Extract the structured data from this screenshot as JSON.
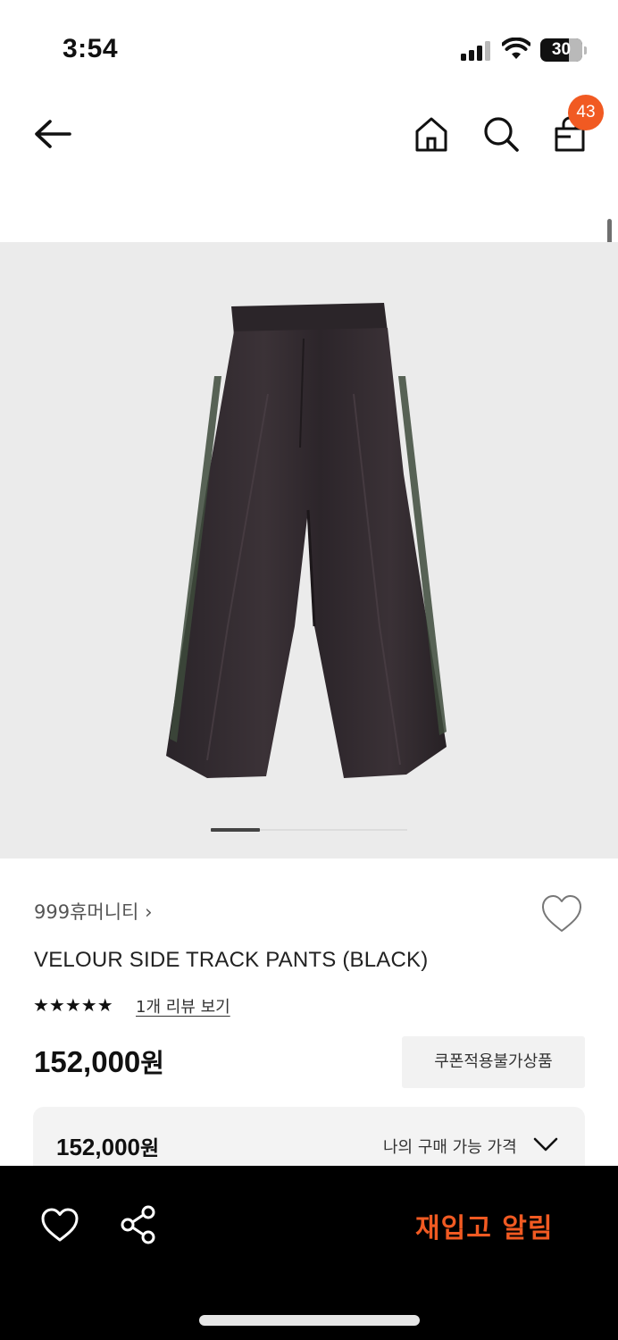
{
  "status_bar": {
    "time": "3:54",
    "battery": "30",
    "signal_icon": "cellular-signal-icon",
    "wifi_icon": "wifi-icon"
  },
  "nav": {
    "back_icon": "arrow-left-icon",
    "home_icon": "home-icon",
    "search_icon": "search-icon",
    "cart_icon": "shopping-bag-icon",
    "cart_badge": "43"
  },
  "gallery": {
    "image": "black velour track pants with green side stripe",
    "page_index": 1
  },
  "product": {
    "brand": "999휴머니티",
    "brand_chevron": "›",
    "name": "VELOUR SIDE TRACK PANTS (BLACK)",
    "stars": "★★★★★",
    "review_link": "1개 리뷰 보기",
    "price_number": "152,000",
    "price_unit": "원",
    "coupon_label": "쿠폰적용불가상품",
    "wishlist_icon": "heart-outline-icon"
  },
  "my_price": {
    "value_number": "152,000",
    "value_unit": "원",
    "label": "나의 구매 가능 가격",
    "toggle_icon": "chevron-down-icon"
  },
  "bottom_bar": {
    "like_icon": "heart-outline-icon",
    "share_icon": "share-icon",
    "restock_button": "재입고 알림"
  },
  "colors": {
    "accent": "#f15a22",
    "gallery_bg": "#ebebeb",
    "bottom_bar_bg": "#000000"
  }
}
